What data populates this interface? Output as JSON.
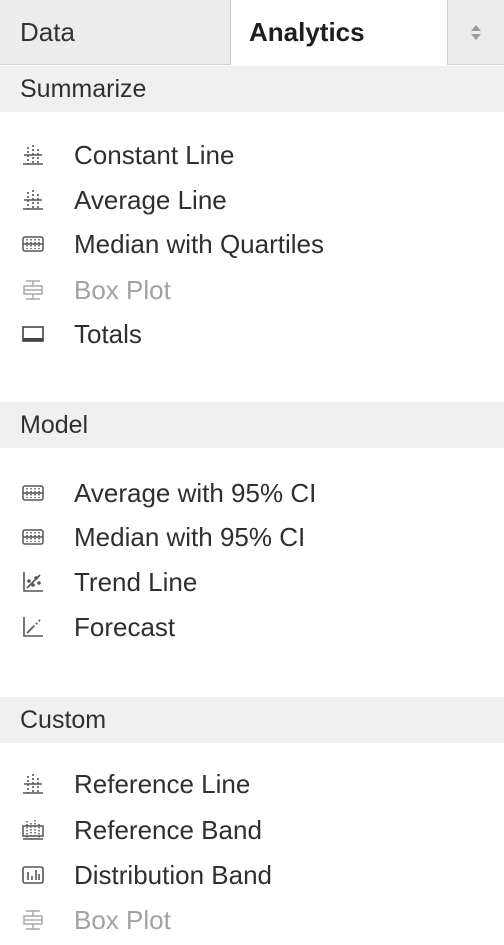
{
  "tabs": {
    "data": "Data",
    "analytics": "Analytics"
  },
  "sections": {
    "summarize": {
      "title": "Summarize",
      "items": [
        {
          "label": "Constant Line",
          "icon": "constant-line-icon",
          "enabled": true
        },
        {
          "label": "Average Line",
          "icon": "average-line-icon",
          "enabled": true
        },
        {
          "label": "Median with Quartiles",
          "icon": "median-quartiles-icon",
          "enabled": true
        },
        {
          "label": "Box Plot",
          "icon": "box-plot-icon",
          "enabled": false
        },
        {
          "label": "Totals",
          "icon": "totals-icon",
          "enabled": true
        }
      ]
    },
    "model": {
      "title": "Model",
      "items": [
        {
          "label": "Average with 95% CI",
          "icon": "average-ci-icon",
          "enabled": true
        },
        {
          "label": "Median with 95% CI",
          "icon": "median-ci-icon",
          "enabled": true
        },
        {
          "label": "Trend Line",
          "icon": "trend-line-icon",
          "enabled": true
        },
        {
          "label": "Forecast",
          "icon": "forecast-icon",
          "enabled": true
        }
      ]
    },
    "custom": {
      "title": "Custom",
      "items": [
        {
          "label": "Reference Line",
          "icon": "reference-line-icon",
          "enabled": true
        },
        {
          "label": "Reference Band",
          "icon": "reference-band-icon",
          "enabled": true
        },
        {
          "label": "Distribution Band",
          "icon": "distribution-band-icon",
          "enabled": true
        },
        {
          "label": "Box Plot",
          "icon": "box-plot-icon",
          "enabled": false
        }
      ]
    }
  },
  "colors": {
    "text": "#2f2f2f",
    "disabled": "#a2a2a2",
    "header_bg": "#f0f0f0",
    "tabbar_bg": "#ececec"
  }
}
